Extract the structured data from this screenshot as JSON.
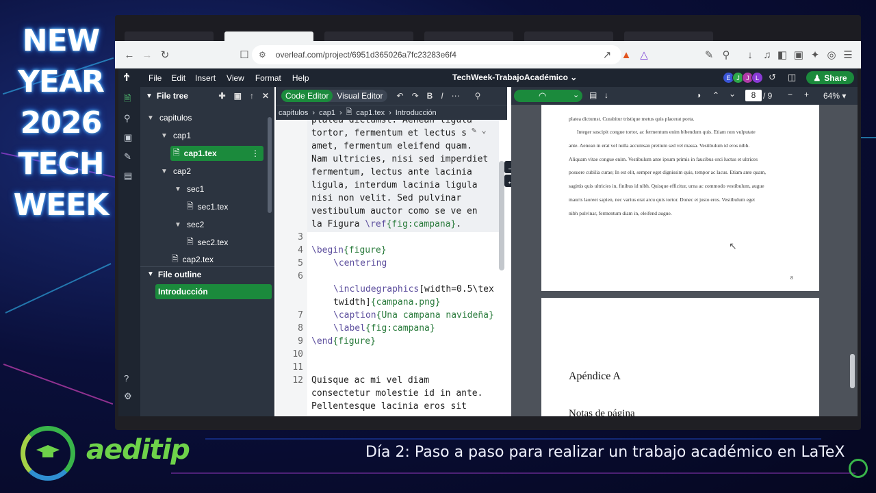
{
  "promo": {
    "lines": [
      "NEW",
      "YEAR",
      "2026",
      "TECH",
      "WEEK"
    ]
  },
  "logo": {
    "text": "aeditip"
  },
  "subtitle": "Día 2: Paso a paso para realizar un trabajo académico en LaTeX",
  "browser": {
    "url": "overleaf.com/project/6951d365026a7fc23283e6f4"
  },
  "app": {
    "menu": [
      "File",
      "Edit",
      "Insert",
      "View",
      "Format",
      "Help"
    ],
    "project_title": "TechWeek-TrabajoAcadémico",
    "avatars": [
      {
        "letter": "E",
        "color": "#3a55d6"
      },
      {
        "letter": "J",
        "color": "#2ea84a"
      },
      {
        "letter": "J",
        "color": "#b03aa8"
      },
      {
        "letter": "L",
        "color": "#8a3ad6"
      }
    ],
    "share_label": "Share"
  },
  "filetree": {
    "title": "File tree",
    "items": [
      {
        "label": "capitulos",
        "type": "folder"
      },
      {
        "label": "cap1",
        "type": "folder"
      },
      {
        "label": "cap1.tex",
        "type": "file",
        "selected": true
      },
      {
        "label": "cap2",
        "type": "folder"
      },
      {
        "label": "sec1",
        "type": "folder"
      },
      {
        "label": "sec1.tex",
        "type": "file"
      },
      {
        "label": "sec2",
        "type": "folder"
      },
      {
        "label": "sec2.tex",
        "type": "file"
      },
      {
        "label": "cap2.tex",
        "type": "file"
      }
    ],
    "outline_title": "File outline",
    "outline_items": [
      "Introducción"
    ]
  },
  "editor": {
    "toggle_code": "Code Editor",
    "toggle_visual": "Visual Editor",
    "breadcrumbs": [
      "capitulos",
      "cap1",
      "cap1.tex",
      "Introducción"
    ],
    "line_numbers": [
      "3",
      "4",
      "5",
      "6",
      "7",
      "8",
      "9",
      "10",
      "11",
      "12"
    ],
    "wrapped_text": [
      "platea dictumst. Aenean ligula",
      "tortor, fermentum et lectus s",
      "amet, fermentum eleifend quam.",
      "Nam ultricies, nisi sed imperdiet",
      "fermentum, lectus ante lacinia",
      "ligula, interdum lacinia ligula",
      "nisi non velit. Sed pulvinar",
      "vestibulum auctor como se ve en"
    ],
    "line2_prefix": "la Figura ",
    "line2_cmd": "\\ref",
    "line2_arg": "{fig:campana}",
    "line2_suffix": ".",
    "begin_cmd": "\\begin",
    "begin_arg": "{figure}",
    "centering": "\\centering",
    "include_cmd": "\\includegraphics",
    "include_opt1": "[width=0.5\\tex",
    "include_opt2": "twidth]",
    "include_arg": "{campana.png}",
    "caption_cmd": "\\caption",
    "caption_arg": "{Una campana navideña}",
    "label_cmd": "\\label",
    "label_arg": "{fig:campana}",
    "end_cmd": "\\end",
    "end_arg": "{figure}",
    "para": [
      "Quisque ac mi vel diam",
      "consectetur molestie id in ante.",
      "Pellentesque lacinia eros sit"
    ]
  },
  "pdf": {
    "page_current": "8",
    "page_total": "/ 9",
    "zoom": "64%",
    "page_text": [
      "platea dictumst. Curabitur tristique metus quis placerat porta.",
      "Integer suscipit congue tortor, ac fermentum enim bibendum quis. Etiam non vulputate",
      "ante. Aenean in erat vel nulla accumsan pretium sed vel massa. Vestibulum id eros nibh.",
      "Aliquam vitae congue enim. Vestibulum ante ipsum primis in faucibus orci luctus et ultrices",
      "posuere cubilia curae; In est elit, semper eget dignissim quis, tempor ac lacus. Etiam ante quam,",
      "sagittis quis ultricies in, finibus id nibh. Quisque efficitur, urna ac commodo vestibulum, augue",
      "mauris laoreet sapien, nec varius erat arcu quis tortor. Donec et justo eros. Vestibulum eget",
      "nibh pulvinar, fermentum diam in, eleifend augue."
    ],
    "page_number": "8",
    "appendix_heading": "Apéndice A",
    "next_heading": "Notas de página"
  }
}
